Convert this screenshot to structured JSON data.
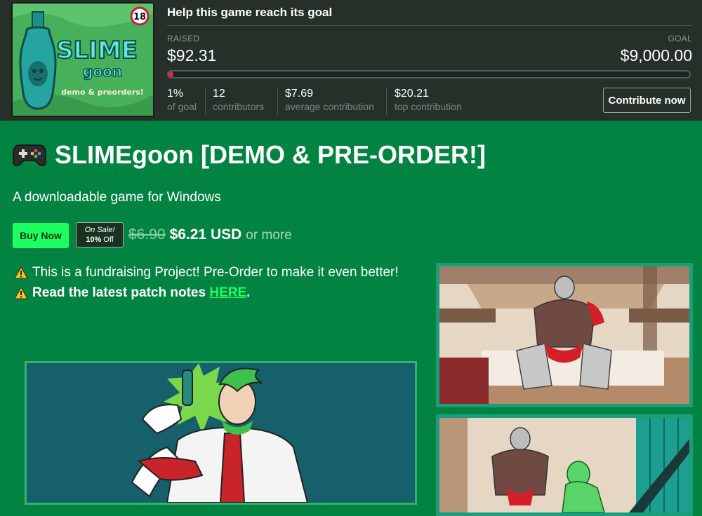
{
  "fundraiser": {
    "heading": "Help this game reach its goal",
    "raised_label": "RAISED",
    "raised_value": "$92.31",
    "goal_label": "GOAL",
    "goal_value": "$9,000.00",
    "progress_fraction": 0.01,
    "stats": [
      {
        "value": "1%",
        "label": "of goal"
      },
      {
        "value": "12",
        "label": "contributors"
      },
      {
        "value": "$7.69",
        "label": "average contribution"
      },
      {
        "value": "$20.21",
        "label": "top contribution"
      }
    ],
    "contribute_label": "Contribute now",
    "progress_color": "#e5264a"
  },
  "cover": {
    "title_line1": "SLIME",
    "title_line2": "goon",
    "tagline": "demo & preorders!",
    "age_badge": "18"
  },
  "game": {
    "title": "SLIMEgoon [DEMO & PRE-ORDER!]",
    "title_icon": "gamepad-icon",
    "subtitle": "A downloadable game for Windows",
    "buy_label": "Buy Now",
    "sale_line1": "On Sale!",
    "sale_line2_pct": "10%",
    "sale_line2_suffix": " Off",
    "old_price": "$6.90",
    "new_price": "$6.21 USD",
    "or_more": "or more"
  },
  "description": {
    "notice1": "This is a fundraising Project! Pre-Order to make it even better!",
    "notice2_prefix": "Read the latest patch notes ",
    "notice2_link": "HERE",
    "notice2_suffix": ".",
    "warning_icon": "warning-icon"
  },
  "colors": {
    "page_bg": "#028342",
    "accent_green": "#1cff5e",
    "topbar_bg": "#263029"
  }
}
